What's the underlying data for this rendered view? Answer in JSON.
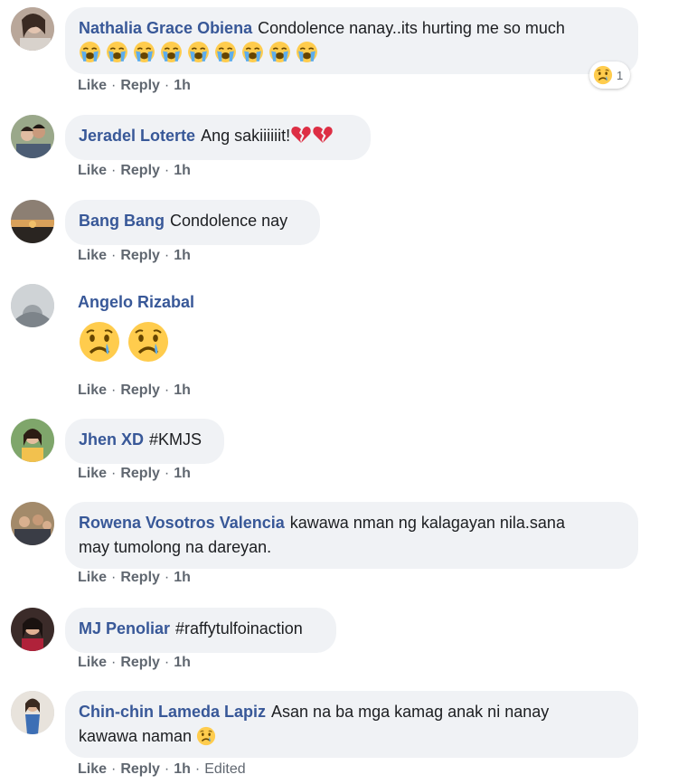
{
  "comments": [
    {
      "author": "Nathalia Grace Obiena",
      "text": "Condolence nanay..its hurting me so much",
      "emoji_count": 9,
      "like": "Like",
      "reply": "Reply",
      "time": "1h",
      "reaction_count": "1"
    },
    {
      "author": "Jeradel Loterte",
      "text": "Ang sakiiiiiit!",
      "like": "Like",
      "reply": "Reply",
      "time": "1h"
    },
    {
      "author": "Bang Bang",
      "text": "Condolence nay",
      "like": "Like",
      "reply": "Reply",
      "time": "1h"
    },
    {
      "author": "Angelo Rizabal",
      "text": "",
      "like": "Like",
      "reply": "Reply",
      "time": "1h"
    },
    {
      "author": "Jhen XD",
      "text": "#KMJS",
      "like": "Like",
      "reply": "Reply",
      "time": "1h"
    },
    {
      "author": "Rowena Vosotros Valencia",
      "text": "kawawa nman ng kalagayan nila.sana",
      "text2": "may tumolong na dareyan.",
      "like": "Like",
      "reply": "Reply",
      "time": "1h"
    },
    {
      "author": "MJ Penoliar",
      "text": "#raffytulfoinaction",
      "like": "Like",
      "reply": "Reply",
      "time": "1h"
    },
    {
      "author": "Chin-chin Lameda Lapiz",
      "text": "Asan na ba mga kamag anak ni nanay",
      "text2": "kawawa naman",
      "like": "Like",
      "reply": "Reply",
      "time": "1h",
      "edited": "Edited"
    }
  ],
  "icons": {
    "crying": "loudly-crying-face-icon",
    "heart": "broken-heart-icon",
    "sad": "crying-face-icon",
    "sad-react": "sad-reaction-icon"
  },
  "colors": {
    "author": "#385898",
    "bubble": "#f0f2f5",
    "meta": "#606770"
  }
}
